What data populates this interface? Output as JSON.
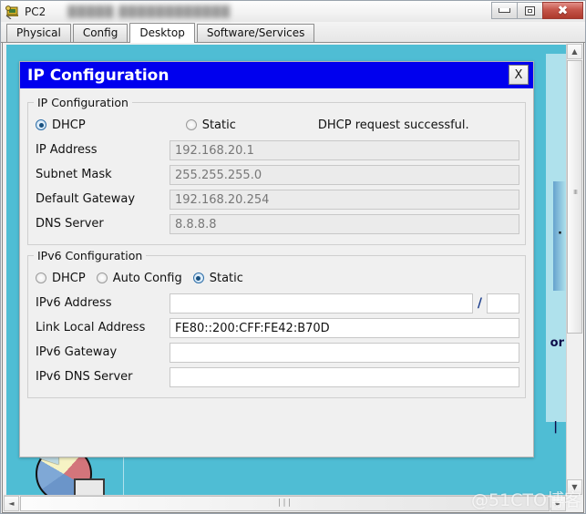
{
  "window": {
    "title": "PC2",
    "blurred_title_suffix": "█████  ████████████",
    "icon": "pc-device-icon",
    "controls": {
      "minimize": "–",
      "maximize": "❐",
      "close": "✕"
    }
  },
  "tabs": [
    {
      "label": "Physical",
      "active": false
    },
    {
      "label": "Config",
      "active": false
    },
    {
      "label": "Desktop",
      "active": true
    },
    {
      "label": "Software/Services",
      "active": false
    }
  ],
  "desktop": {
    "background_color": "#4FBDD4",
    "icon_label": "",
    "behind_text_fragments": [
      "or",
      "·",
      "|"
    ]
  },
  "dialog": {
    "title": "IP Configuration",
    "close_label": "X",
    "ipv4": {
      "group_label": "IP Configuration",
      "modes": [
        {
          "label": "DHCP",
          "selected": true
        },
        {
          "label": "Static",
          "selected": false
        }
      ],
      "status": "DHCP request successful.",
      "fields": [
        {
          "label": "IP Address",
          "value": "192.168.20.1",
          "editable": false
        },
        {
          "label": "Subnet Mask",
          "value": "255.255.255.0",
          "editable": false
        },
        {
          "label": "Default Gateway",
          "value": "192.168.20.254",
          "editable": false
        },
        {
          "label": "DNS Server",
          "value": "8.8.8.8",
          "editable": false
        }
      ]
    },
    "ipv6": {
      "group_label": "IPv6 Configuration",
      "modes": [
        {
          "label": "DHCP",
          "selected": false
        },
        {
          "label": "Auto Config",
          "selected": false
        },
        {
          "label": "Static",
          "selected": true
        }
      ],
      "address_label": "IPv6 Address",
      "address_value": "",
      "prefix_separator": "/",
      "prefix_value": "",
      "fields": [
        {
          "label": "Link Local Address",
          "value": "FE80::200:CFF:FE42:B70D",
          "editable": true
        },
        {
          "label": "IPv6 Gateway",
          "value": "",
          "editable": true
        },
        {
          "label": "IPv6 DNS Server",
          "value": "",
          "editable": true
        }
      ]
    }
  },
  "scrollbars": {
    "vertical": {
      "up": "▲",
      "down": "▼",
      "grip": "≡"
    },
    "horizontal": {
      "left": "◄",
      "right": "►",
      "grip": "∣∣∣"
    }
  },
  "watermark": "@51CTO博客"
}
